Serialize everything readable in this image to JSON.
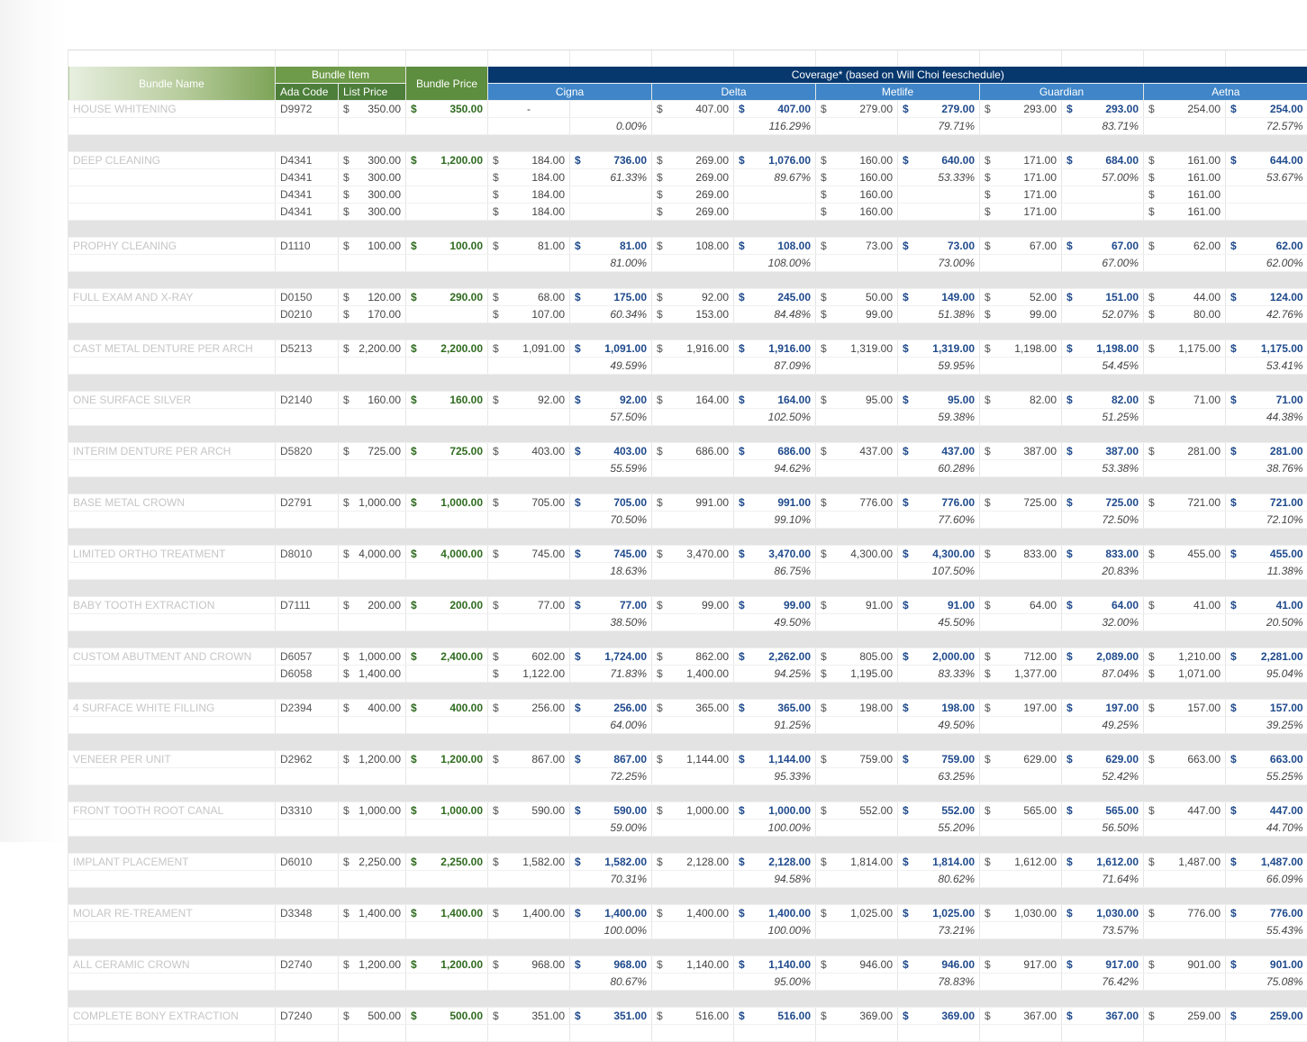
{
  "headers": {
    "bundle_name": "Bundle Name",
    "bundle_item": "Bundle Item",
    "ada_code": "Ada Code",
    "list_price": "List Price",
    "bundle_price": "Bundle Price",
    "coverage": "Coverage* (based on Will Choi feeschedule)",
    "insurers": [
      "Cigna",
      "Delta",
      "Metlife",
      "Guardian",
      "Aetna"
    ]
  },
  "currency": "$",
  "dash": "-",
  "bundles": [
    {
      "name": "HOUSE WHITENING",
      "bundle_price": "350.00",
      "items": [
        {
          "ada": "D9972",
          "list": "350.00",
          "fees": [
            "-",
            "407.00",
            "279.00",
            "293.00",
            "254.00"
          ],
          "totals": [
            "",
            "407.00",
            "279.00",
            "293.00",
            "254.00"
          ],
          "pcts": [
            "0.00%",
            "116.29%",
            "79.71%",
            "83.71%",
            "72.57%"
          ]
        }
      ]
    },
    {
      "name": "DEEP CLEANING",
      "bundle_price": "1,200.00",
      "items": [
        {
          "ada": "D4341",
          "list": "300.00",
          "fees": [
            "184.00",
            "269.00",
            "160.00",
            "171.00",
            "161.00"
          ],
          "totals": [
            "736.00",
            "1,076.00",
            "640.00",
            "684.00",
            "644.00"
          ],
          "pcts": [
            "",
            "",
            "",
            "",
            ""
          ]
        },
        {
          "ada": "D4341",
          "list": "300.00",
          "fees": [
            "184.00",
            "269.00",
            "160.00",
            "171.00",
            "161.00"
          ],
          "totals": [
            "",
            "",
            "",
            "",
            ""
          ],
          "pcts": [
            "61.33%",
            "89.67%",
            "53.33%",
            "57.00%",
            "53.67%"
          ]
        },
        {
          "ada": "D4341",
          "list": "300.00",
          "fees": [
            "184.00",
            "269.00",
            "160.00",
            "171.00",
            "161.00"
          ],
          "totals": [
            "",
            "",
            "",
            "",
            ""
          ],
          "pcts": [
            "",
            "",
            "",
            "",
            ""
          ]
        },
        {
          "ada": "D4341",
          "list": "300.00",
          "fees": [
            "184.00",
            "269.00",
            "160.00",
            "171.00",
            "161.00"
          ],
          "totals": [
            "",
            "",
            "",
            "",
            ""
          ],
          "pcts": [
            "",
            "",
            "",
            "",
            ""
          ]
        }
      ]
    },
    {
      "name": "PROPHY CLEANING",
      "bundle_price": "100.00",
      "items": [
        {
          "ada": "D1110",
          "list": "100.00",
          "fees": [
            "81.00",
            "108.00",
            "73.00",
            "67.00",
            "62.00"
          ],
          "totals": [
            "81.00",
            "108.00",
            "73.00",
            "67.00",
            "62.00"
          ],
          "pcts": [
            "81.00%",
            "108.00%",
            "73.00%",
            "67.00%",
            "62.00%"
          ]
        }
      ]
    },
    {
      "name": "FULL EXAM AND X-RAY",
      "bundle_price": "290.00",
      "items": [
        {
          "ada": "D0150",
          "list": "120.00",
          "fees": [
            "68.00",
            "92.00",
            "50.00",
            "52.00",
            "44.00"
          ],
          "totals": [
            "175.00",
            "245.00",
            "149.00",
            "151.00",
            "124.00"
          ],
          "pcts": [
            "",
            "",
            "",
            "",
            ""
          ]
        },
        {
          "ada": "D0210",
          "list": "170.00",
          "fees": [
            "107.00",
            "153.00",
            "99.00",
            "99.00",
            "80.00"
          ],
          "totals": [
            "",
            "",
            "",
            "",
            ""
          ],
          "pcts": [
            "60.34%",
            "84.48%",
            "51.38%",
            "52.07%",
            "42.76%"
          ]
        }
      ]
    },
    {
      "name": "CAST METAL DENTURE PER ARCH",
      "bundle_price": "2,200.00",
      "items": [
        {
          "ada": "D5213",
          "list": "2,200.00",
          "fees": [
            "1,091.00",
            "1,916.00",
            "1,319.00",
            "1,198.00",
            "1,175.00"
          ],
          "totals": [
            "1,091.00",
            "1,916.00",
            "1,319.00",
            "1,198.00",
            "1,175.00"
          ],
          "pcts": [
            "49.59%",
            "87.09%",
            "59.95%",
            "54.45%",
            "53.41%"
          ]
        }
      ]
    },
    {
      "name": "ONE SURFACE SILVER",
      "bundle_price": "160.00",
      "items": [
        {
          "ada": "D2140",
          "list": "160.00",
          "fees": [
            "92.00",
            "164.00",
            "95.00",
            "82.00",
            "71.00"
          ],
          "totals": [
            "92.00",
            "164.00",
            "95.00",
            "82.00",
            "71.00"
          ],
          "pcts": [
            "57.50%",
            "102.50%",
            "59.38%",
            "51.25%",
            "44.38%"
          ]
        }
      ]
    },
    {
      "name": "INTERIM DENTURE PER ARCH",
      "bundle_price": "725.00",
      "items": [
        {
          "ada": "D5820",
          "list": "725.00",
          "fees": [
            "403.00",
            "686.00",
            "437.00",
            "387.00",
            "281.00"
          ],
          "totals": [
            "403.00",
            "686.00",
            "437.00",
            "387.00",
            "281.00"
          ],
          "pcts": [
            "55.59%",
            "94.62%",
            "60.28%",
            "53.38%",
            "38.76%"
          ]
        }
      ]
    },
    {
      "name": "BASE METAL CROWN",
      "bundle_price": "1,000.00",
      "items": [
        {
          "ada": "D2791",
          "list": "1,000.00",
          "fees": [
            "705.00",
            "991.00",
            "776.00",
            "725.00",
            "721.00"
          ],
          "totals": [
            "705.00",
            "991.00",
            "776.00",
            "725.00",
            "721.00"
          ],
          "pcts": [
            "70.50%",
            "99.10%",
            "77.60%",
            "72.50%",
            "72.10%"
          ]
        }
      ]
    },
    {
      "name": "LIMITED ORTHO TREATMENT",
      "bundle_price": "4,000.00",
      "items": [
        {
          "ada": "D8010",
          "list": "4,000.00",
          "fees": [
            "745.00",
            "3,470.00",
            "4,300.00",
            "833.00",
            "455.00"
          ],
          "totals": [
            "745.00",
            "3,470.00",
            "4,300.00",
            "833.00",
            "455.00"
          ],
          "pcts": [
            "18.63%",
            "86.75%",
            "107.50%",
            "20.83%",
            "11.38%"
          ]
        }
      ]
    },
    {
      "name": "BABY TOOTH EXTRACTION",
      "bundle_price": "200.00",
      "items": [
        {
          "ada": "D7111",
          "list": "200.00",
          "fees": [
            "77.00",
            "99.00",
            "91.00",
            "64.00",
            "41.00"
          ],
          "totals": [
            "77.00",
            "99.00",
            "91.00",
            "64.00",
            "41.00"
          ],
          "pcts": [
            "38.50%",
            "49.50%",
            "45.50%",
            "32.00%",
            "20.50%"
          ]
        }
      ]
    },
    {
      "name": "CUSTOM ABUTMENT AND CROWN",
      "bundle_price": "2,400.00",
      "items": [
        {
          "ada": "D6057",
          "list": "1,000.00",
          "fees": [
            "602.00",
            "862.00",
            "805.00",
            "712.00",
            "1,210.00"
          ],
          "totals": [
            "1,724.00",
            "2,262.00",
            "2,000.00",
            "2,089.00",
            "2,281.00"
          ],
          "pcts": [
            "",
            "",
            "",
            "",
            ""
          ]
        },
        {
          "ada": "D6058",
          "list": "1,400.00",
          "fees": [
            "1,122.00",
            "1,400.00",
            "1,195.00",
            "1,377.00",
            "1,071.00"
          ],
          "totals": [
            "",
            "",
            "",
            "",
            ""
          ],
          "pcts": [
            "71.83%",
            "94.25%",
            "83.33%",
            "87.04%",
            "95.04%"
          ]
        }
      ]
    },
    {
      "name": "4 SURFACE WHITE FILLING",
      "bundle_price": "400.00",
      "items": [
        {
          "ada": "D2394",
          "list": "400.00",
          "fees": [
            "256.00",
            "365.00",
            "198.00",
            "197.00",
            "157.00"
          ],
          "totals": [
            "256.00",
            "365.00",
            "198.00",
            "197.00",
            "157.00"
          ],
          "pcts": [
            "64.00%",
            "91.25%",
            "49.50%",
            "49.25%",
            "39.25%"
          ]
        }
      ]
    },
    {
      "name": "VENEER PER UNIT",
      "bundle_price": "1,200.00",
      "items": [
        {
          "ada": "D2962",
          "list": "1,200.00",
          "fees": [
            "867.00",
            "1,144.00",
            "759.00",
            "629.00",
            "663.00"
          ],
          "totals": [
            "867.00",
            "1,144.00",
            "759.00",
            "629.00",
            "663.00"
          ],
          "pcts": [
            "72.25%",
            "95.33%",
            "63.25%",
            "52.42%",
            "55.25%"
          ]
        }
      ]
    },
    {
      "name": "FRONT TOOTH ROOT CANAL",
      "bundle_price": "1,000.00",
      "items": [
        {
          "ada": "D3310",
          "list": "1,000.00",
          "fees": [
            "590.00",
            "1,000.00",
            "552.00",
            "565.00",
            "447.00"
          ],
          "totals": [
            "590.00",
            "1,000.00",
            "552.00",
            "565.00",
            "447.00"
          ],
          "pcts": [
            "59.00%",
            "100.00%",
            "55.20%",
            "56.50%",
            "44.70%"
          ]
        }
      ]
    },
    {
      "name": "IMPLANT PLACEMENT",
      "bundle_price": "2,250.00",
      "items": [
        {
          "ada": "D6010",
          "list": "2,250.00",
          "fees": [
            "1,582.00",
            "2,128.00",
            "1,814.00",
            "1,612.00",
            "1,487.00"
          ],
          "totals": [
            "1,582.00",
            "2,128.00",
            "1,814.00",
            "1,612.00",
            "1,487.00"
          ],
          "pcts": [
            "70.31%",
            "94.58%",
            "80.62%",
            "71.64%",
            "66.09%"
          ]
        }
      ]
    },
    {
      "name": "MOLAR RE-TREAMENT",
      "bundle_price": "1,400.00",
      "items": [
        {
          "ada": "D3348",
          "list": "1,400.00",
          "fees": [
            "1,400.00",
            "1,400.00",
            "1,025.00",
            "1,030.00",
            "776.00"
          ],
          "totals": [
            "1,400.00",
            "1,400.00",
            "1,025.00",
            "1,030.00",
            "776.00"
          ],
          "pcts": [
            "100.00%",
            "100.00%",
            "73.21%",
            "73.57%",
            "55.43%"
          ]
        }
      ]
    },
    {
      "name": "ALL CERAMIC CROWN",
      "bundle_price": "1,200.00",
      "items": [
        {
          "ada": "D2740",
          "list": "1,200.00",
          "fees": [
            "968.00",
            "1,140.00",
            "946.00",
            "917.00",
            "901.00"
          ],
          "totals": [
            "968.00",
            "1,140.00",
            "946.00",
            "917.00",
            "901.00"
          ],
          "pcts": [
            "80.67%",
            "95.00%",
            "78.83%",
            "76.42%",
            "75.08%"
          ]
        }
      ]
    },
    {
      "name": "COMPLETE BONY EXTRACTION",
      "bundle_price": "500.00",
      "items": [
        {
          "ada": "D7240",
          "list": "500.00",
          "fees": [
            "351.00",
            "516.00",
            "369.00",
            "367.00",
            "259.00"
          ],
          "totals": [
            "351.00",
            "516.00",
            "369.00",
            "367.00",
            "259.00"
          ],
          "pcts": [
            "",
            "",
            "",
            "",
            ""
          ]
        }
      ]
    }
  ]
}
